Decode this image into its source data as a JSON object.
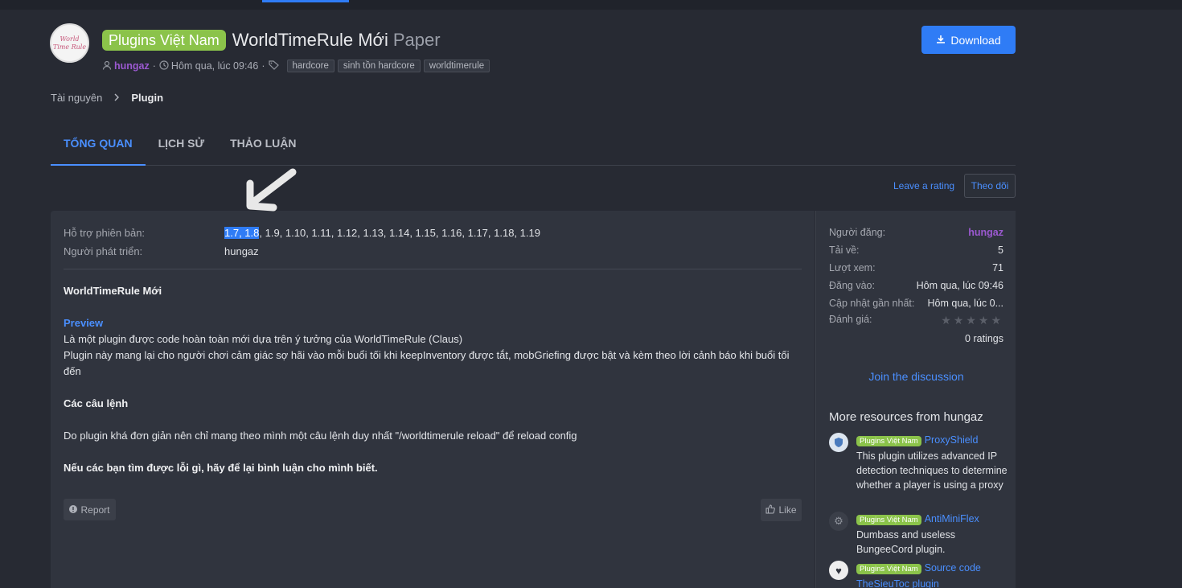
{
  "header": {
    "avatar_text": "World Time Rule",
    "prefix": "Plugins Việt Nam",
    "title": "WorldTimeRule Mới",
    "version_label": "Paper",
    "author": "hungaz",
    "date": "Hôm qua, lúc 09:46",
    "tags": [
      "hardcore",
      "sinh tồn hardcore",
      "worldtimerule"
    ],
    "download_label": "Download"
  },
  "breadcrumb": {
    "parent": "Tài nguyên",
    "current": "Plugin"
  },
  "tabs": [
    "TỔNG QUAN",
    "LỊCH SỬ",
    "THẢO LUẬN"
  ],
  "actions": {
    "leave_rating": "Leave a rating",
    "follow": "Theo dõi"
  },
  "info": {
    "versions_label": "Hỗ trợ phiên bản:",
    "versions_selected": "1.7, 1.8",
    "versions_rest": ", 1.9, 1.10, 1.11, 1.12, 1.13, 1.14, 1.15, 1.16, 1.17, 1.18, 1.19",
    "developer_label": "Người phát triển:",
    "developer": "hungaz"
  },
  "content": {
    "heading": "WorldTimeRule Mới",
    "preview_heading": "Preview",
    "preview_line1": "Là một plugin được code hoàn toàn mới dựa trên ý tưởng của WorldTimeRule (Claus)",
    "preview_line2": "Plugin này mang lại cho người chơi cảm giác sợ hãi vào mỗi buổi tối khi keepInventory được tắt, mobGriefing được bật và kèm theo lời cảnh báo khi buổi tối đến",
    "commands_heading": "Các câu lệnh",
    "commands_text": "Do plugin khá đơn giản nên chỉ mang theo mình một câu lệnh duy nhất \"/worldtimerule reload\" để reload config",
    "bugs_text": "Nếu các bạn tìm được lỗi gì, hãy để lại bình luận cho mình biết.",
    "report_label": "Report",
    "like_label": "Like"
  },
  "sidebar": {
    "poster_label": "Người đăng:",
    "poster": "hungaz",
    "downloads_label": "Tải về:",
    "downloads": "5",
    "views_label": "Lượt xem:",
    "views": "71",
    "posted_label": "Đăng vào:",
    "posted": "Hôm qua, lúc 09:46",
    "updated_label": "Cập nhật gần nhất:",
    "updated": "Hôm qua, lúc 0...",
    "rating_label": "Đánh giá:",
    "rating_value": 0,
    "ratings_count": "0 ratings",
    "join_label": "Join the discussion",
    "more_heading": "More resources from hungaz",
    "resources": [
      {
        "prefix": "Plugins Việt Nam",
        "title": "ProxyShield",
        "desc": "This plugin utilizes advanced IP detection techniques to determine whether a player is using a proxy",
        "icon": "shield-icon"
      },
      {
        "prefix": "Plugins Việt Nam",
        "title": "AntiMiniFlex",
        "desc": "Dumbass and useless BungeeCord plugin.",
        "icon": "gear-icon"
      },
      {
        "prefix": "Plugins Việt Nam",
        "title": "Source code TheSieuToc plugin",
        "desc": "",
        "icon": "heart-icon"
      }
    ]
  },
  "colors": {
    "accent": "#2f7cf6",
    "prefix_green": "#8bc34a",
    "author_purple": "#9b59d0",
    "background": "#272a33",
    "panel": "#30343e"
  }
}
